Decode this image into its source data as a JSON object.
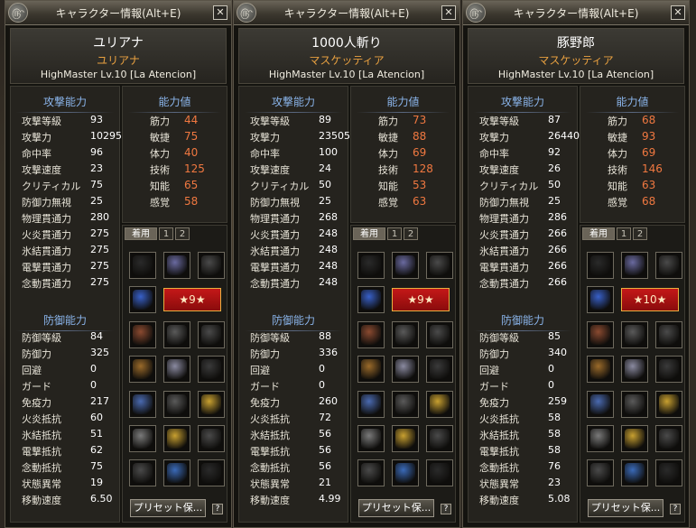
{
  "window_title": "キャラクター情報(Alt+E)",
  "close_glyph": "✕",
  "logo_glyph": "௹",
  "section_labels": {
    "attack": "攻撃能力",
    "ability": "能力値",
    "defense": "防御能力"
  },
  "equip_tabs": [
    "着用",
    "1",
    "2"
  ],
  "preset_button": "プリセット保...",
  "help_button": "?",
  "attack_labels": [
    "攻撃等級",
    "攻撃力",
    "命中率",
    "攻撃速度",
    "クリティカル",
    "防御力無視",
    "物理貫通力",
    "火炎貫通力",
    "氷結貫通力",
    "電撃貫通力",
    "念動貫通力"
  ],
  "ability_labels": [
    "筋力",
    "敏捷",
    "体力",
    "技術",
    "知能",
    "感覚"
  ],
  "defense_labels": [
    "防御等級",
    "防御力",
    "回避",
    "ガード",
    "免疫力",
    "火炎抵抗",
    "氷結抵抗",
    "電撃抵抗",
    "念動抵抗",
    "状態異常",
    "移動速度"
  ],
  "characters": [
    {
      "name": "ユリアナ",
      "class": "ユリアナ",
      "level": "HighMaster Lv.10 [La Atencion]",
      "title_badge": "★9★",
      "attack": [
        "93",
        "10295",
        "96",
        "23",
        "75",
        "25",
        "280",
        "275",
        "275",
        "275",
        "275"
      ],
      "ability": [
        "44",
        "75",
        "40",
        "125",
        "65",
        "58"
      ],
      "defense": [
        "84",
        "325",
        "0",
        "0",
        "217",
        "60",
        "51",
        "62",
        "75",
        "19",
        "6.50"
      ]
    },
    {
      "name": "1000人斬り",
      "class": "マスケッティア",
      "level": "HighMaster Lv.10 [La Atencion]",
      "title_badge": "★9★",
      "attack": [
        "89",
        "23505",
        "100",
        "24",
        "50",
        "25",
        "268",
        "248",
        "248",
        "248",
        "248"
      ],
      "ability": [
        "73",
        "88",
        "69",
        "128",
        "53",
        "63"
      ],
      "defense": [
        "88",
        "336",
        "0",
        "0",
        "260",
        "72",
        "56",
        "56",
        "56",
        "21",
        "4.99"
      ]
    },
    {
      "name": "豚野郎",
      "class": "マスケッティア",
      "level": "HighMaster Lv.10 [La Atencion]",
      "title_badge": "★10★",
      "attack": [
        "87",
        "26440",
        "92",
        "26",
        "50",
        "25",
        "286",
        "266",
        "266",
        "266",
        "266"
      ],
      "ability": [
        "68",
        "93",
        "69",
        "146",
        "63",
        "68"
      ],
      "defense": [
        "85",
        "340",
        "0",
        "0",
        "259",
        "58",
        "58",
        "58",
        "76",
        "23",
        "5.08"
      ]
    }
  ],
  "slot_colors": [
    "#2a2a2a",
    "#6a6aa0",
    "#4a4a4a",
    "#3860c8",
    "#8a4a30",
    "#5a5a5a",
    "#4a4a4a",
    "#9a6a2a",
    "#8a8aa0",
    "#3a3a3a",
    "#4a6ab0",
    "#5a5a5a",
    "#c8a030",
    "#7a7a7a",
    "#c8a030",
    "#4a4a4a",
    "#4a4a4a",
    "#3a6ab8"
  ]
}
